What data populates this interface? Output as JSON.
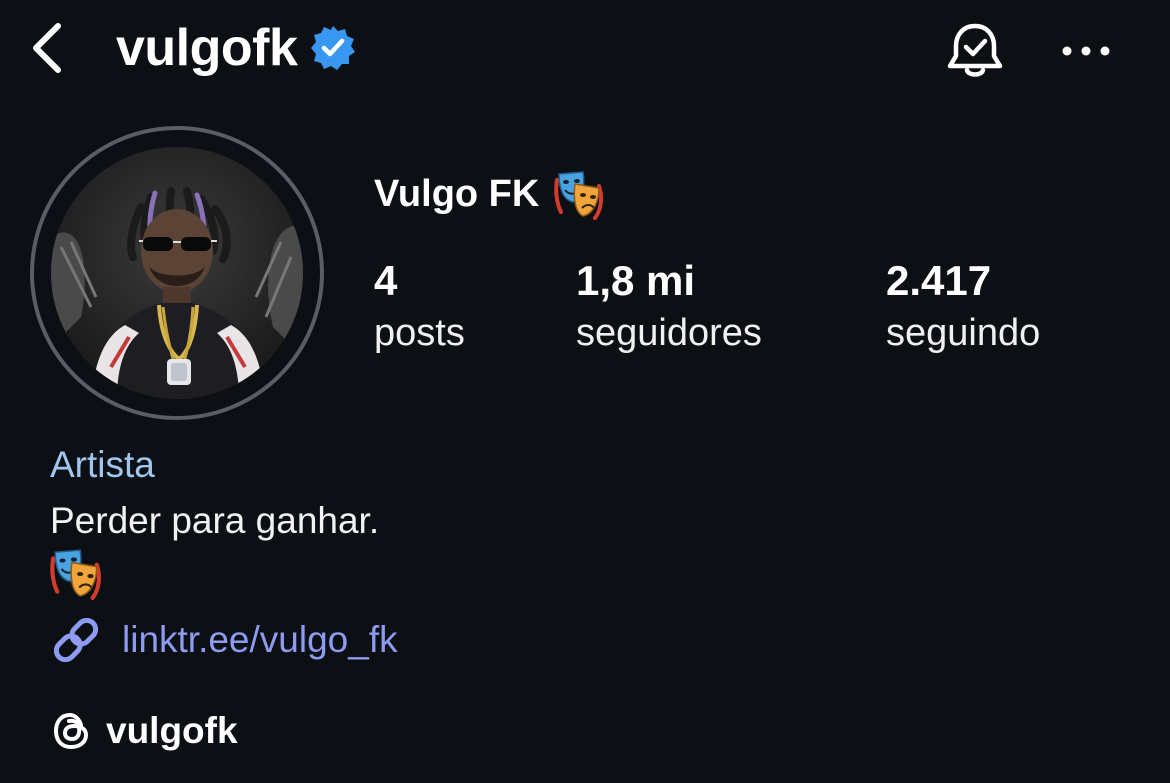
{
  "header": {
    "username": "vulgofk",
    "verified": true,
    "icons": {
      "back": "back-chevron-icon",
      "verified": "verified-badge-icon",
      "bell": "notification-bell-check-icon",
      "more": "more-options-icon"
    },
    "verified_color": "#3897f0"
  },
  "profile": {
    "display_name": "Vulgo FK",
    "display_name_emoji": "performing-arts-masks",
    "avatar": "profile-photo"
  },
  "stats": {
    "posts": {
      "value": "4",
      "label": "posts"
    },
    "followers": {
      "value": "1,8 mi",
      "label": "seguidores"
    },
    "following": {
      "value": "2.417",
      "label": "seguindo"
    }
  },
  "bio": {
    "category": "Artista",
    "text": "Perder para ganhar.",
    "emoji": "performing-arts-masks",
    "link": "linktr.ee/vulgo_fk",
    "threads_handle": "vulgofk",
    "colors": {
      "category": "#9fc6ec",
      "link": "#8d9cf0"
    }
  }
}
